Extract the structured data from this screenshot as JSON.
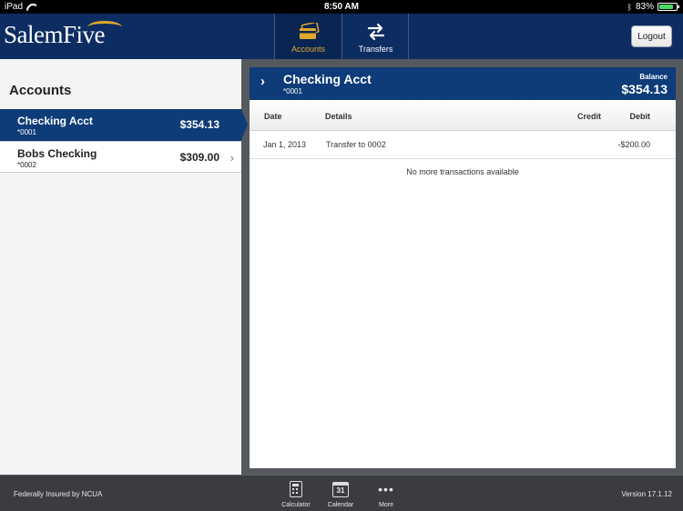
{
  "status_bar": {
    "device": "iPad",
    "time": "8:50 AM",
    "battery": "83%",
    "battery_level": 0.83
  },
  "header": {
    "logo": "SalemFive",
    "tabs": [
      {
        "label": "Accounts",
        "icon": "card-icon",
        "active": true
      },
      {
        "label": "Transfers",
        "icon": "transfer-arrows-icon",
        "active": false
      }
    ],
    "logout_label": "Logout"
  },
  "accounts_panel": {
    "title": "Accounts",
    "items": [
      {
        "name": "Checking Acct",
        "number": "*0001",
        "balance": "$354.13",
        "selected": true
      },
      {
        "name": "Bobs Checking",
        "number": "*0002",
        "balance": "$309.00",
        "selected": false
      }
    ]
  },
  "account_detail": {
    "name": "Checking Acct",
    "number": "*0001",
    "balance_label": "Balance",
    "balance": "$354.13",
    "columns": {
      "date": "Date",
      "details": "Details",
      "credit": "Credit",
      "debit": "Debit"
    },
    "transactions": [
      {
        "date": "Jan 1, 2013",
        "details": "Transfer to 0002",
        "credit": "",
        "debit": "-$200.00"
      }
    ],
    "empty_message": "No more transactions available"
  },
  "footer": {
    "insured_text": "Federally Insured by NCUA",
    "tools": [
      {
        "label": "Calculator",
        "icon": "calculator-icon"
      },
      {
        "label": "Calendar",
        "icon": "calendar-icon",
        "icon_text": "31"
      },
      {
        "label": "More",
        "icon": "more-dots-icon"
      }
    ],
    "version": "Version 17.1.12"
  },
  "colors": {
    "header_bg": "#0d2d62",
    "selected_bg": "#0d3c78",
    "accent": "#e0a92d"
  }
}
